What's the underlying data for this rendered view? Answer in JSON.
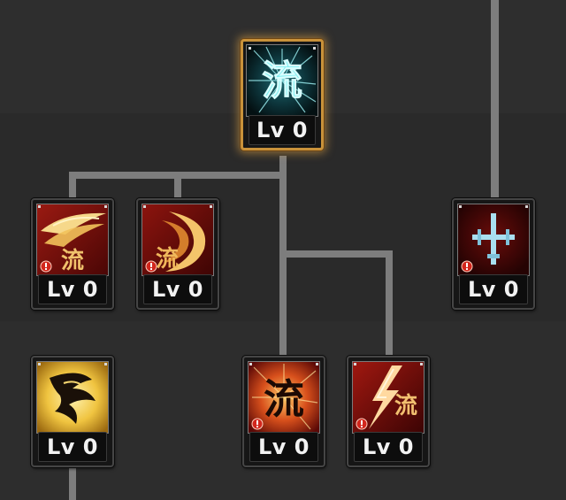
{
  "skill_tree": {
    "skills": [
      {
        "id": "top",
        "icon": "cyan-flow-icon",
        "glyph": "流",
        "level_label": "Lv 0",
        "selected": true
      },
      {
        "id": "mid-1",
        "icon": "golden-wave-slash-icon",
        "glyph": "流",
        "level_label": "Lv 0",
        "locked": true
      },
      {
        "id": "mid-2",
        "icon": "crescent-slash-icon",
        "glyph": "流",
        "level_label": "Lv 0",
        "locked": true
      },
      {
        "id": "mid-3",
        "icon": "sword-cross-icon",
        "level_label": "Lv 0",
        "locked": true
      },
      {
        "id": "bottom-1",
        "icon": "dragon-claw-icon",
        "level_label": "Lv 0"
      },
      {
        "id": "bottom-2",
        "icon": "flow-burst-icon",
        "glyph": "流",
        "level_label": "Lv 0",
        "locked": true
      },
      {
        "id": "bottom-3",
        "icon": "lightning-flow-icon",
        "glyph": "流",
        "level_label": "Lv 0",
        "locked": true
      }
    ]
  },
  "colors": {
    "background": "#2c2c2c",
    "connector": "#7d7d7d",
    "selected_border": "#c9923a",
    "cyan_glyph": "#6ee6ea",
    "red_icon_bg": "#7a0e0a"
  }
}
